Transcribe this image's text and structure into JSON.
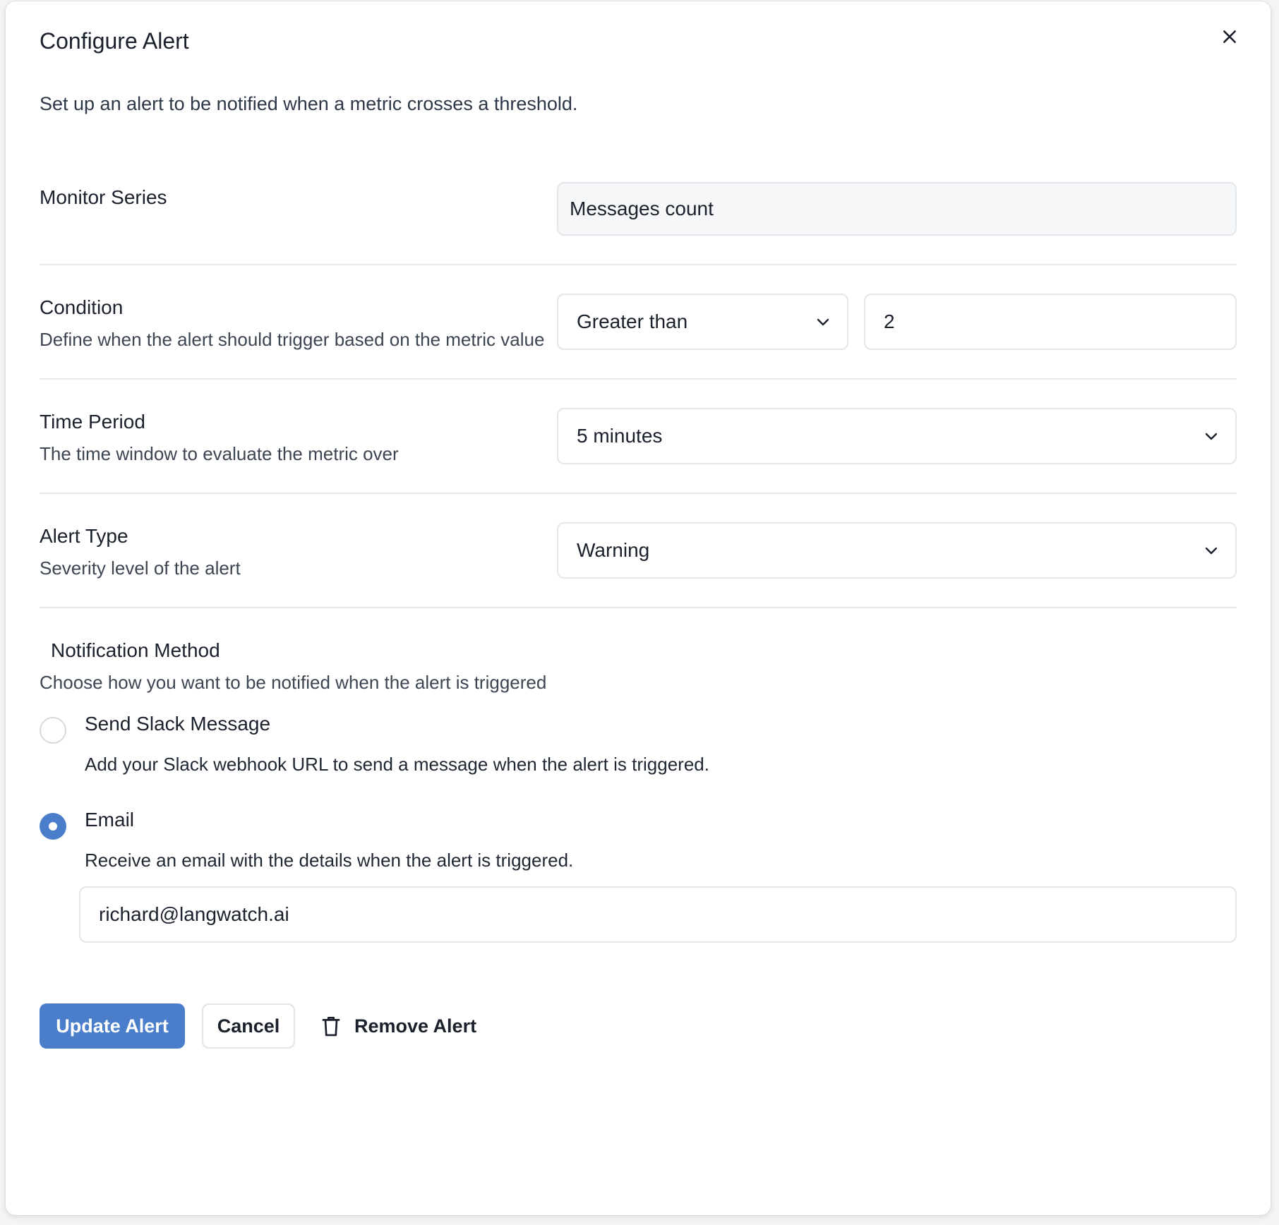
{
  "dialog": {
    "title": "Configure Alert",
    "description": "Set up an alert to be notified when a metric crosses a threshold.",
    "close_icon": "close-icon"
  },
  "monitor_series": {
    "label": "Monitor Series",
    "value": "Messages count"
  },
  "condition": {
    "label": "Condition",
    "help": "Define when the alert should trigger based on the metric value",
    "operator": "Greater than",
    "threshold": "2"
  },
  "time_period": {
    "label": "Time Period",
    "help": "The time window to evaluate the metric over",
    "value": "5 minutes"
  },
  "alert_type": {
    "label": "Alert Type",
    "help": "Severity level of the alert",
    "value": "Warning"
  },
  "notification": {
    "label": "Notification Method",
    "help": "Choose how you want to be notified when the alert is triggered",
    "options": [
      {
        "label": "Send Slack Message",
        "help": "Add your Slack webhook URL to send a message when the alert is triggered.",
        "selected": false
      },
      {
        "label": "Email",
        "help": "Receive an email with the details when the alert is triggered.",
        "selected": true
      }
    ],
    "email_value": "richard@langwatch.ai"
  },
  "actions": {
    "update_label": "Update Alert",
    "cancel_label": "Cancel",
    "remove_label": "Remove Alert",
    "remove_icon": "trash-icon"
  },
  "colors": {
    "accent": "#4a7ecb",
    "border": "#e3e6ea",
    "text": "#1a202c"
  }
}
